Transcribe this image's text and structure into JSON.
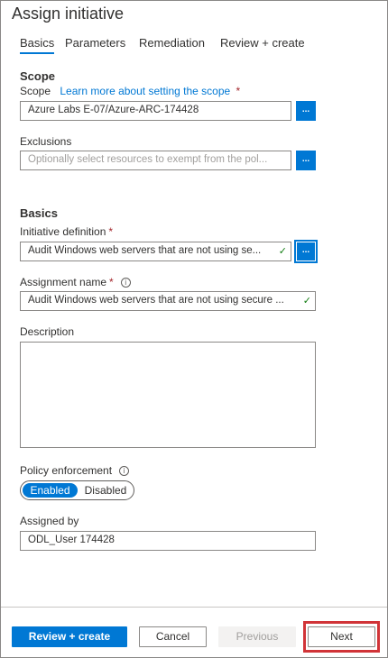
{
  "title": "Assign initiative",
  "tabs": [
    {
      "label": "Basics"
    },
    {
      "label": "Parameters"
    },
    {
      "label": "Remediation"
    },
    {
      "label": "Review + create"
    }
  ],
  "scope": {
    "heading": "Scope",
    "label": "Scope",
    "link": "Learn more about setting the scope",
    "value": "Azure Labs E-07/Azure-ARC-174428",
    "button": "..."
  },
  "exclusions": {
    "label": "Exclusions",
    "placeholder": "Optionally select resources to exempt from the pol...",
    "button": "..."
  },
  "basics": {
    "heading": "Basics",
    "initiative_label": "Initiative definition",
    "initiative_value": "Audit Windows web servers that are not using se...",
    "initiative_button": "...",
    "assignment_label": "Assignment name",
    "assignment_value": "Audit Windows web servers that are not using secure ...",
    "description_label": "Description",
    "description_value": "",
    "enforcement_label": "Policy enforcement",
    "enforcement_on": "Enabled",
    "enforcement_off": "Disabled",
    "assigned_by_label": "Assigned by",
    "assigned_by_value": "ODL_User 174428"
  },
  "required_mark": "*",
  "info_glyph": "i",
  "check_glyph": "✓",
  "footer": {
    "review_create": "Review + create",
    "cancel": "Cancel",
    "previous": "Previous",
    "next": "Next"
  },
  "colors": {
    "accent": "#0078d4",
    "required": "#a4262c",
    "valid": "#107c10",
    "highlight": "#d13438"
  }
}
